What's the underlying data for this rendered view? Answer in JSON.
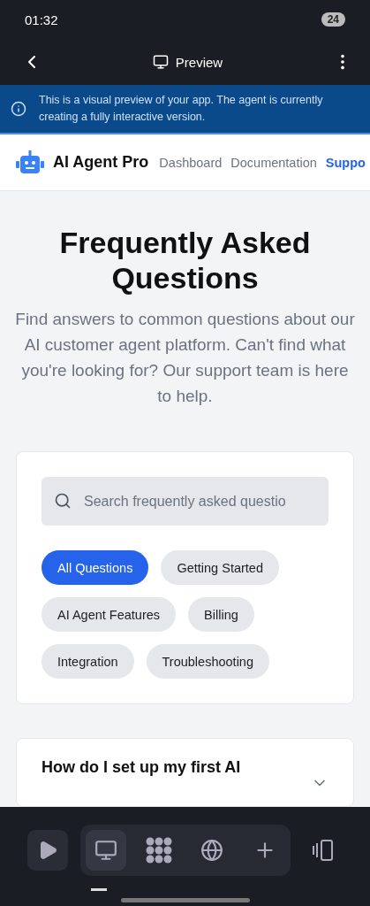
{
  "status_bar": {
    "time": "01:32",
    "battery": "24"
  },
  "app_bar": {
    "title": "Preview"
  },
  "banner": {
    "text": "This is a visual preview of your app. The agent is currently creating a fully interactive version."
  },
  "site_header": {
    "brand": "AI Agent Pro",
    "nav": [
      {
        "label": "Dashboard",
        "selected": false
      },
      {
        "label": "Documentation",
        "selected": false
      },
      {
        "label": "Suppo",
        "selected": true
      }
    ]
  },
  "hero": {
    "title": "Frequently Asked Questions",
    "subtitle": "Find answers to common questions about our AI customer agent platform. Can't find what you're looking for? Our support team is here to help."
  },
  "search": {
    "placeholder": "Search frequently asked questio"
  },
  "categories": [
    {
      "label": "All Questions",
      "selected": true
    },
    {
      "label": "Getting Started",
      "selected": false
    },
    {
      "label": "AI Agent Features",
      "selected": false
    },
    {
      "label": "Billing",
      "selected": false
    },
    {
      "label": "Integration",
      "selected": false
    },
    {
      "label": "Troubleshooting",
      "selected": false
    }
  ],
  "faq": [
    {
      "question": "How do I set up my first AI",
      "expanded": false
    }
  ],
  "toolbar": {
    "items": [
      {
        "kind": "play",
        "selected": false
      },
      {
        "kind": "desktop",
        "selected": true
      },
      {
        "kind": "dots",
        "selected": false
      },
      {
        "kind": "globe",
        "selected": false
      },
      {
        "kind": "plus",
        "selected": false
      },
      {
        "kind": "devices",
        "selected": false
      }
    ]
  }
}
